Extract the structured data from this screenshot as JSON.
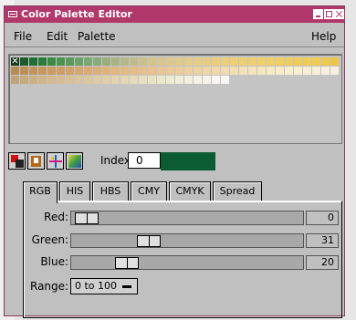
{
  "window": {
    "title": "Color Palette Editor",
    "titlebar_color": "#b0386a"
  },
  "menu": {
    "file": "File",
    "edit": "Edit",
    "palette": "Palette",
    "help": "Help"
  },
  "palette": {
    "rows": [
      [
        "#173c20",
        "#1e5a2c",
        "#1f6e34",
        "#2a7a3a",
        "#3a8a44",
        "#4a9350",
        "#5a9a5c",
        "#6aa268",
        "#7aa874",
        "#8aab7c",
        "#9aaf80",
        "#a8b384",
        "#b4b788",
        "#c0bc8a",
        "#cac08c",
        "#d2c48c",
        "#d8c68c",
        "#dcc88c",
        "#e0ca8a",
        "#e4cb88",
        "#e6cc86",
        "#e8cc82",
        "#eacd7e",
        "#ecce7a",
        "#edcf76",
        "#eed072",
        "#efd06e",
        "#f0d06a",
        "#f0d066",
        "#f0cf62",
        "#f0ce5e",
        "#f0cc5a",
        "#f0cb56",
        "#f0ca52",
        "#efc84e",
        "#eec64a"
      ],
      [
        "#b88c56",
        "#bc9058",
        "#c0945c",
        "#c49860",
        "#c89c64",
        "#cca068",
        "#d0a46c",
        "#d4a870",
        "#d8ac74",
        "#dbb078",
        "#deb47c",
        "#e0b780",
        "#e2ba84",
        "#e4bd88",
        "#e6c08c",
        "#e8c390",
        "#eac694",
        "#ecc998",
        "#edcc9c",
        "#eecfa0",
        "#efd2a4",
        "#f0d5a8",
        "#f1d8ac",
        "#f2dbb0",
        "#f3deb4",
        "#f4e1b8",
        "#f5e4bc",
        "#f6e7c0",
        "#f7eac4",
        "#f8edc8",
        "#f8efcc",
        "#f8f0d0",
        "#f8f0d4",
        "#f8f0d8",
        "#f8f0dc",
        "#f8f0e0"
      ],
      [
        "#c0a478",
        "#c6aa7e",
        "#ccb084",
        "#d0b48a",
        "#d4b890",
        "#d6bc94",
        "#d8c098",
        "#dac49c",
        "#dcc8a0",
        "#decca6",
        "#e0d0aa",
        "#e2d4ae",
        "#e4d8b4",
        "#e6dcba",
        "#e8e0c0",
        "#eae4c6",
        "#ece8cc",
        "#eeecd2",
        "#f0eed8",
        "#f2f0de",
        "#f4f2e4",
        "#f6f4ea",
        "#f8f6f0",
        "#faf8f4"
      ]
    ],
    "selected_mark": "✕"
  },
  "toolbar": {
    "tools": [
      "paint-icon",
      "bucket-icon",
      "sparkle-icon",
      "gradient-icon"
    ],
    "index_label": "Index:",
    "index_value": "0",
    "current_color": "#0c5c33"
  },
  "tabs": [
    "RGB",
    "HIS",
    "HBS",
    "CMY",
    "CMYK",
    "Spread"
  ],
  "active_tab": "RGB",
  "sliders": [
    {
      "label": "Red:",
      "value": "0",
      "fraction": 0.0
    },
    {
      "label": "Green:",
      "value": "31",
      "fraction": 0.31
    },
    {
      "label": "Blue:",
      "value": "20",
      "fraction": 0.2
    }
  ],
  "range": {
    "label": "Range:",
    "value": "0 to 100"
  }
}
